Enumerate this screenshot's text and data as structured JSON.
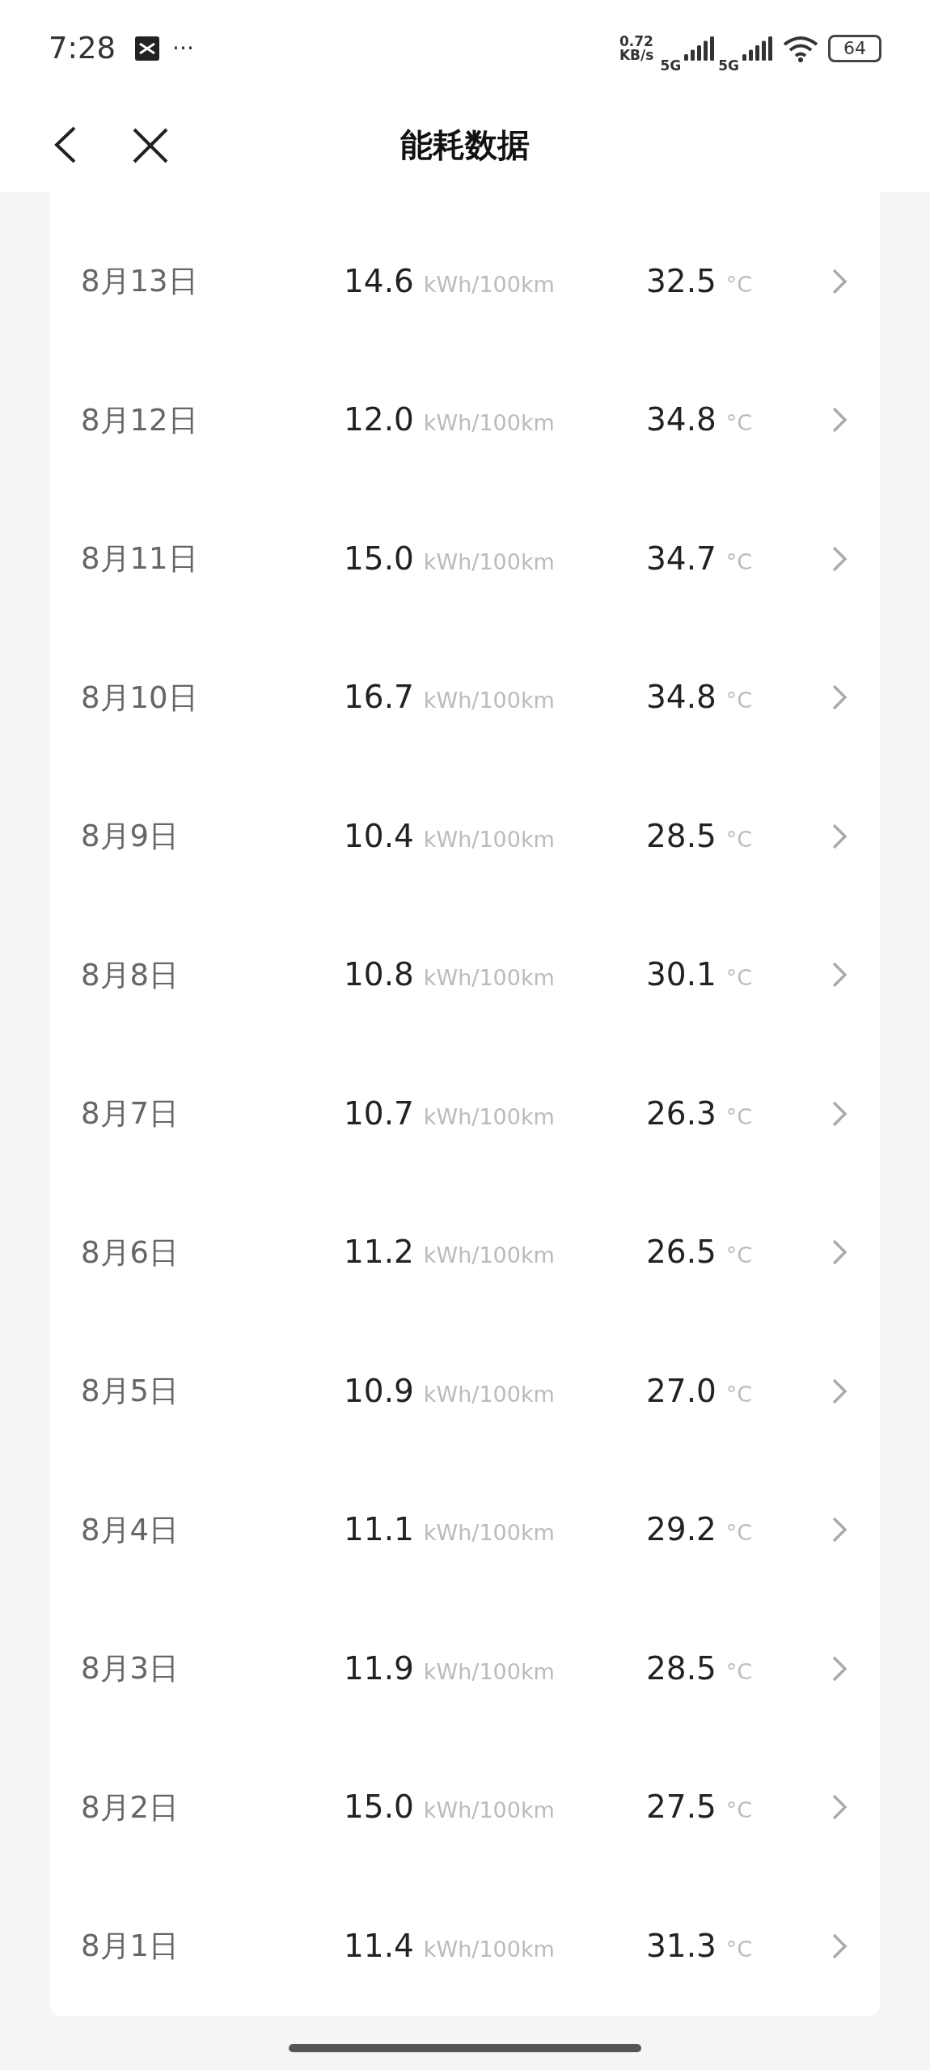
{
  "status_bar": {
    "time": "7:28",
    "more": "···",
    "net_speed": [
      "0.72",
      "KB/s"
    ],
    "signals": [
      "5G",
      "5G"
    ],
    "battery": "64"
  },
  "header": {
    "title": "能耗数据"
  },
  "rows": [
    {
      "date": "8月13日",
      "consumption": "14.6",
      "consumption_unit": "kWh/100km",
      "temperature": "32.5",
      "temperature_unit": "°C"
    },
    {
      "date": "8月12日",
      "consumption": "12.0",
      "consumption_unit": "kWh/100km",
      "temperature": "34.8",
      "temperature_unit": "°C"
    },
    {
      "date": "8月11日",
      "consumption": "15.0",
      "consumption_unit": "kWh/100km",
      "temperature": "34.7",
      "temperature_unit": "°C"
    },
    {
      "date": "8月10日",
      "consumption": "16.7",
      "consumption_unit": "kWh/100km",
      "temperature": "34.8",
      "temperature_unit": "°C"
    },
    {
      "date": "8月9日",
      "consumption": "10.4",
      "consumption_unit": "kWh/100km",
      "temperature": "28.5",
      "temperature_unit": "°C"
    },
    {
      "date": "8月8日",
      "consumption": "10.8",
      "consumption_unit": "kWh/100km",
      "temperature": "30.1",
      "temperature_unit": "°C"
    },
    {
      "date": "8月7日",
      "consumption": "10.7",
      "consumption_unit": "kWh/100km",
      "temperature": "26.3",
      "temperature_unit": "°C"
    },
    {
      "date": "8月6日",
      "consumption": "11.2",
      "consumption_unit": "kWh/100km",
      "temperature": "26.5",
      "temperature_unit": "°C"
    },
    {
      "date": "8月5日",
      "consumption": "10.9",
      "consumption_unit": "kWh/100km",
      "temperature": "27.0",
      "temperature_unit": "°C"
    },
    {
      "date": "8月4日",
      "consumption": "11.1",
      "consumption_unit": "kWh/100km",
      "temperature": "29.2",
      "temperature_unit": "°C"
    },
    {
      "date": "8月3日",
      "consumption": "11.9",
      "consumption_unit": "kWh/100km",
      "temperature": "28.5",
      "temperature_unit": "°C"
    },
    {
      "date": "8月2日",
      "consumption": "15.0",
      "consumption_unit": "kWh/100km",
      "temperature": "27.5",
      "temperature_unit": "°C"
    },
    {
      "date": "8月1日",
      "consumption": "11.4",
      "consumption_unit": "kWh/100km",
      "temperature": "31.3",
      "temperature_unit": "°C"
    }
  ]
}
